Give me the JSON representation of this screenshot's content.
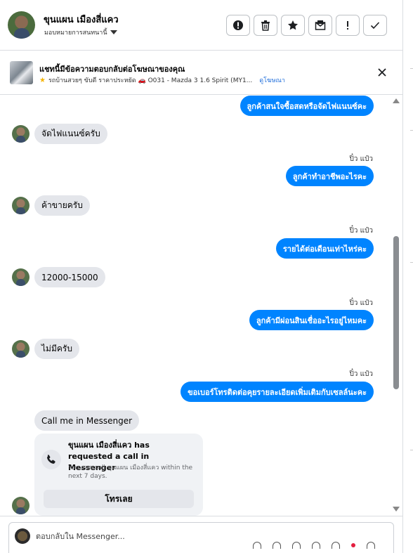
{
  "header": {
    "contact_name": "ขุนแผน เมืองสี่แคว",
    "assign_label": "มอบหมายการสนทนานี้",
    "actions": [
      "spam-icon",
      "trash-icon",
      "star-icon",
      "mark-unread-icon",
      "important-icon",
      "done-icon"
    ]
  },
  "ad_context": {
    "title": "แชทนี้มีข้อความตอบกลับต่อโฆษณาของคุณ",
    "subtitle": "รถบ้านสวยๆ ขับดี ราคาประหยัด 🚗 O031 - Mazda 3 1.6 Spirit (MY1...",
    "view_ad_link": "ดูโฆษณา"
  },
  "messages": [
    {
      "from": "page",
      "text": "ลูกค้าสนใจซื้อสดหรือจัดไฟแนนซ์คะ"
    },
    {
      "from": "customer",
      "text": "จัดไฟแนนซ์ครับ"
    },
    {
      "from": "page",
      "sender": "ปิ๋ว แป๋ว",
      "text": "ลูกค้าทำอาชีพอะไรคะ"
    },
    {
      "from": "customer",
      "text": "ค้าขายครับ"
    },
    {
      "from": "page",
      "sender": "ปิ๋ว แป๋ว",
      "text": "รายได้ต่อเดือนเท่าไหร่คะ"
    },
    {
      "from": "customer",
      "text": "12000-15000"
    },
    {
      "from": "page",
      "sender": "ปิ๋ว แป๋ว",
      "text": "ลูกค้ามีผ่อนสินเชื่ออะไรอยู่ไหมคะ"
    },
    {
      "from": "customer",
      "text": "ไม่มีครับ"
    },
    {
      "from": "page",
      "sender": "ปิ๋ว แป๋ว",
      "text": "ขอเบอร์โทรติดต่อคุยรายละเอียดเพิ่มเติมกับเซลล์นะคะ"
    },
    {
      "from": "customer",
      "text": "Call me in Messenger"
    }
  ],
  "call_card": {
    "title": "ขุนแผน เมืองสี่แคว has requested a call in Messenger",
    "body": "You can call ขุนแผน เมืองสี่แคว within the next 7 days.",
    "button": "โทรเลย"
  },
  "composer": {
    "placeholder": "ตอบกลับใน Messenger..."
  },
  "colors": {
    "outgoing_bubble": "#0084ff",
    "incoming_bubble": "#e4e6eb",
    "link": "#216fdb"
  }
}
